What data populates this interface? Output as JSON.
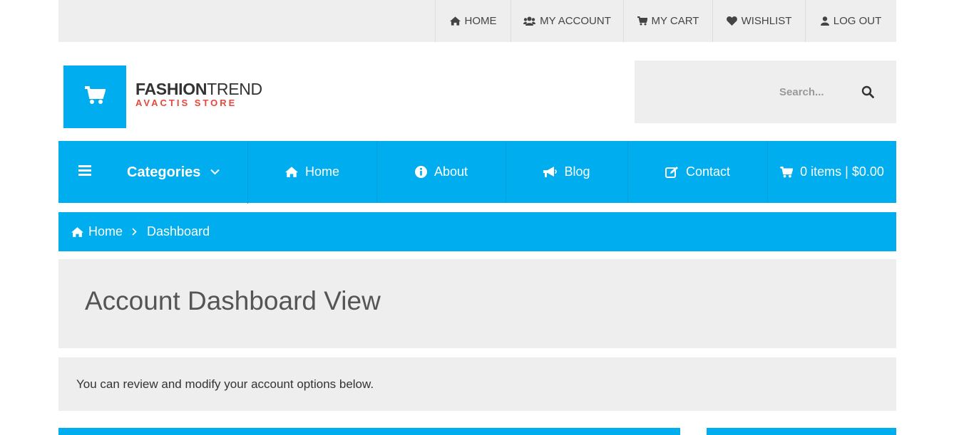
{
  "colors": {
    "accent": "#00adef",
    "panel": "#eeeeee",
    "brand_sub": "#e8473b"
  },
  "top_links": [
    {
      "label": "HOME",
      "icon": "home-icon"
    },
    {
      "label": "MY ACCOUNT",
      "icon": "users-icon"
    },
    {
      "label": "MY CART",
      "icon": "cart-icon"
    },
    {
      "label": "WISHLIST",
      "icon": "heart-icon"
    },
    {
      "label": "LOG OUT",
      "icon": "user-icon"
    }
  ],
  "brand": {
    "name_bold": "FASHION",
    "name_light": "TREND",
    "tagline": "AVACTIS STORE",
    "logo_icon": "cart-icon"
  },
  "search": {
    "placeholder": "Search...",
    "icon": "search-icon"
  },
  "nav": {
    "categories_label": "Categories",
    "items": [
      {
        "label": "Home",
        "icon": "home-icon"
      },
      {
        "label": "About",
        "icon": "info-icon"
      },
      {
        "label": "Blog",
        "icon": "bullhorn-icon"
      },
      {
        "label": "Contact",
        "icon": "edit-icon"
      },
      {
        "label": "0 items | $0.00",
        "icon": "cart-icon"
      }
    ]
  },
  "breadcrumb": {
    "home": "Home",
    "current": "Dashboard"
  },
  "page": {
    "title": "Account Dashboard View",
    "intro": "You can review and modify your account options below."
  }
}
